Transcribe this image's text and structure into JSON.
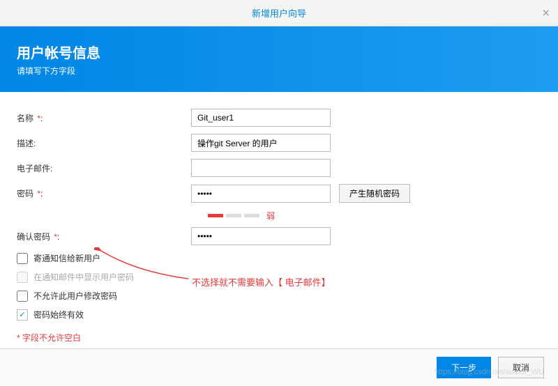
{
  "dialog": {
    "title": "新增用户向导",
    "close_icon": "×"
  },
  "banner": {
    "title": "用户帐号信息",
    "subtitle": "请填写下方字段"
  },
  "form": {
    "name_label": "名称",
    "name_value": "Git_user1",
    "desc_label": "描述:",
    "desc_value": "操作git Server 的用户",
    "email_label": "电子邮件:",
    "email_value": "",
    "password_label": "密码",
    "password_value": "•••••",
    "gen_pwd_label": "产生随机密码",
    "strength_text": "弱",
    "confirm_pwd_label": "确认密码",
    "confirm_pwd_value": "•••••"
  },
  "checkboxes": {
    "notify_label": "寄通知信给新用户",
    "show_pwd_label": "在通知邮件中显示用户密码",
    "disallow_change_label": "不允许此用户修改密码",
    "pwd_valid_label": "密码始终有效"
  },
  "annotation": {
    "text": "不选择就不需要输入【 电子邮件】"
  },
  "blank_note": "字段不允许空白",
  "footer": {
    "next_label": "下一步",
    "cancel_label": "取消"
  },
  "watermark": "https://blog.csdn.net/author_WU"
}
